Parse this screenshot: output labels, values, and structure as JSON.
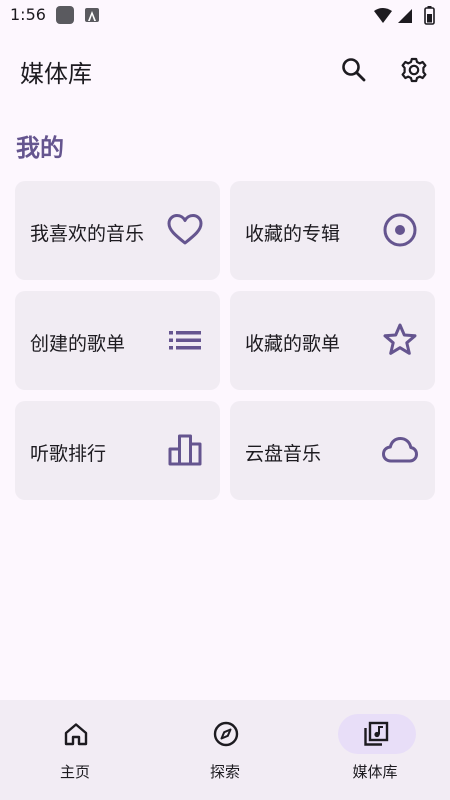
{
  "status_bar": {
    "time": "1:56"
  },
  "app_bar": {
    "title": "媒体库"
  },
  "section": {
    "title": "我的"
  },
  "tiles": [
    {
      "label": "我喜欢的音乐",
      "icon": "heart-icon"
    },
    {
      "label": "收藏的专辑",
      "icon": "album-icon"
    },
    {
      "label": "创建的歌单",
      "icon": "list-icon"
    },
    {
      "label": "收藏的歌单",
      "icon": "star-icon"
    },
    {
      "label": "听歌排行",
      "icon": "bar-chart-icon"
    },
    {
      "label": "云盘音乐",
      "icon": "cloud-icon"
    }
  ],
  "nav": [
    {
      "label": "主页",
      "icon": "home-icon",
      "selected": false
    },
    {
      "label": "探索",
      "icon": "compass-icon",
      "selected": false
    },
    {
      "label": "媒体库",
      "icon": "library-music-icon",
      "selected": true
    }
  ],
  "colors": {
    "accent": "#65558f",
    "background": "#fdf7fe",
    "tile": "#f1ecf3",
    "nav_background": "#f2ecf4",
    "nav_pill": "#e8def8"
  }
}
